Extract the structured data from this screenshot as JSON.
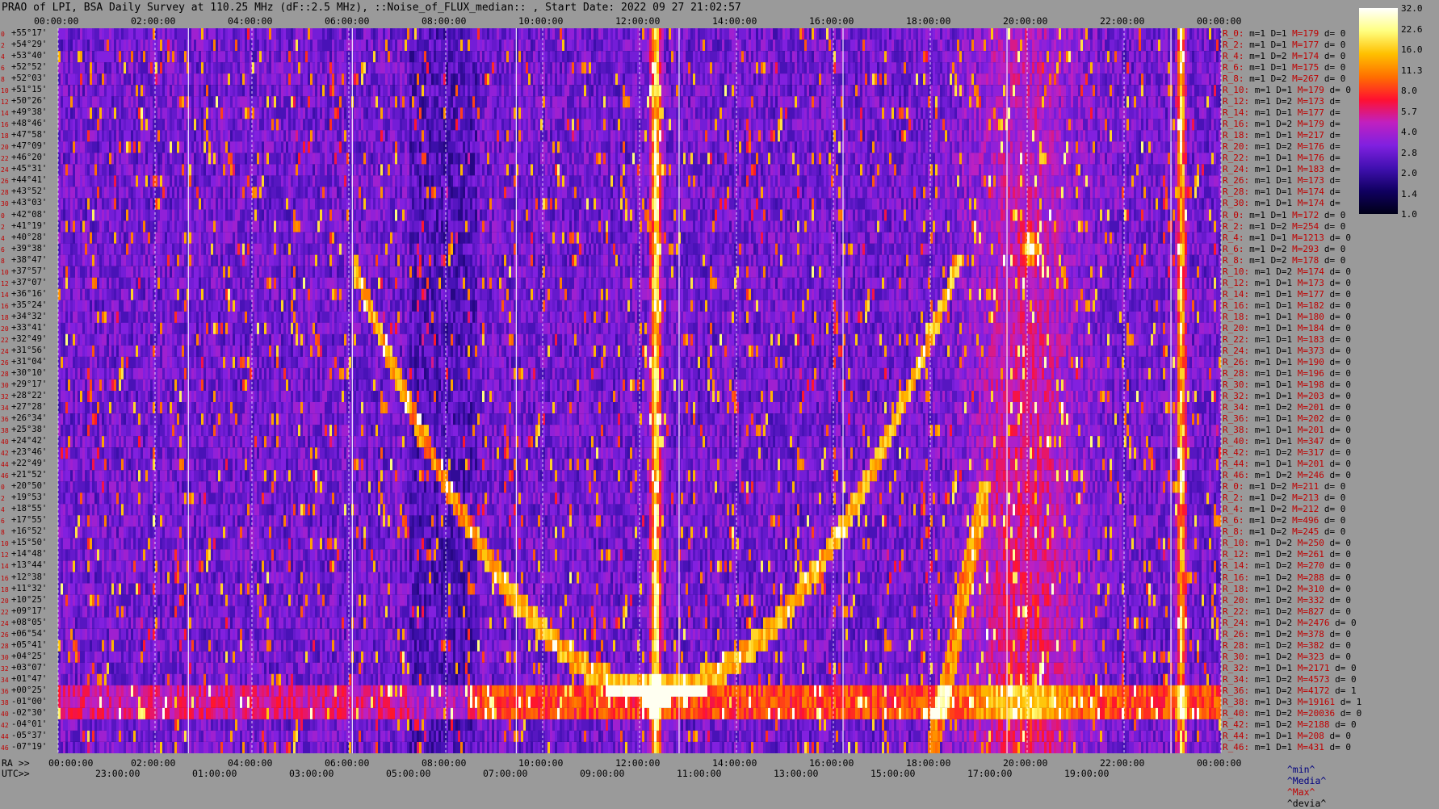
{
  "title": "PRAO of LPI, BSA Daily Survey at 110.25 MHz (dF::2.5 MHz), ::Noise_of_FLUX_median:: , Start Date: 2022 09 27 21:02:57",
  "chart_data": {
    "type": "heatmap",
    "title": "PRAO of LPI, BSA Daily Survey at 110.25 MHz (dF::2.5 MHz), ::Noise_of_FLUX_median:: , Start Date: 2022 09 27 21:02:57",
    "x_top_ticks": [
      "00:00:00",
      "02:00:00",
      "04:00:00",
      "06:00:00",
      "08:00:00",
      "10:00:00",
      "12:00:00",
      "14:00:00",
      "16:00:00",
      "18:00:00",
      "20:00:00",
      "22:00:00",
      "00:00:00"
    ],
    "x_ra_label": "RA >>",
    "x_ra_ticks": [
      "00:00:00",
      "02:00:00",
      "04:00:00",
      "06:00:00",
      "08:00:00",
      "10:00:00",
      "12:00:00",
      "14:00:00",
      "16:00:00",
      "18:00:00",
      "20:00:00",
      "22:00:00",
      "00:00:00"
    ],
    "x_utc_label": "UTC>>",
    "x_utc_ticks": [
      "23:00:00",
      "01:00:00",
      "03:00:00",
      "05:00:00",
      "07:00:00",
      "09:00:00",
      "11:00:00",
      "13:00:00",
      "15:00:00",
      "17:00:00",
      "19:00:00"
    ],
    "colorbar": {
      "ticks": [
        "32.0",
        "22.6",
        "16.0",
        "11.3",
        "8.0",
        "5.7",
        "4.0",
        "2.8",
        "2.0",
        "1.4",
        "1.0"
      ],
      "range": [
        1.0,
        32.0
      ],
      "scale": "log",
      "colors": [
        "#000018",
        "#100060",
        "#4010b0",
        "#8020e0",
        "#c020c0",
        "#ff1030",
        "#ff7000",
        "#ffc000",
        "#ffff80",
        "#ffffff"
      ]
    },
    "rows": [
      {
        "dec": "+55°17'",
        "beam": "0",
        "r": "R_0:",
        "m": "1",
        "d": "1",
        "max": "179",
        "dev": "0"
      },
      {
        "dec": "+54°29'",
        "beam": "2",
        "r": "R_2:",
        "m": "1",
        "d": "1",
        "max": "177",
        "dev": "0"
      },
      {
        "dec": "+53°40'",
        "beam": "4",
        "r": "R_4:",
        "m": "1",
        "d": "2",
        "max": "174",
        "dev": "0"
      },
      {
        "dec": "+52°52'",
        "beam": "6",
        "r": "R_6:",
        "m": "1",
        "d": "1",
        "max": "175",
        "dev": "0"
      },
      {
        "dec": "+52°03'",
        "beam": "8",
        "r": "R_8:",
        "m": "1",
        "d": "2",
        "max": "267",
        "dev": "0"
      },
      {
        "dec": "+51°15'",
        "beam": "10",
        "r": "R_10:",
        "m": "1",
        "d": "1",
        "max": "179",
        "dev": "0"
      },
      {
        "dec": "+50°26'",
        "beam": "12",
        "r": "R_12:",
        "m": "1",
        "d": "2",
        "max": "173",
        "dev": ""
      },
      {
        "dec": "+49°38'",
        "beam": "14",
        "r": "R_14:",
        "m": "1",
        "d": "1",
        "max": "177",
        "dev": ""
      },
      {
        "dec": "+48°46'",
        "beam": "16",
        "r": "R_16:",
        "m": "1",
        "d": "2",
        "max": "179",
        "dev": ""
      },
      {
        "dec": "+47°58'",
        "beam": "18",
        "r": "R_18:",
        "m": "1",
        "d": "1",
        "max": "217",
        "dev": ""
      },
      {
        "dec": "+47°09'",
        "beam": "20",
        "r": "R_20:",
        "m": "1",
        "d": "2",
        "max": "176",
        "dev": ""
      },
      {
        "dec": "+46°20'",
        "beam": "22",
        "r": "R_22:",
        "m": "1",
        "d": "1",
        "max": "176",
        "dev": ""
      },
      {
        "dec": "+45°31'",
        "beam": "24",
        "r": "R_24:",
        "m": "1",
        "d": "1",
        "max": "183",
        "dev": ""
      },
      {
        "dec": "+44°41'",
        "beam": "26",
        "r": "R_26:",
        "m": "1",
        "d": "1",
        "max": "173",
        "dev": ""
      },
      {
        "dec": "+43°52'",
        "beam": "28",
        "r": "R_28:",
        "m": "1",
        "d": "1",
        "max": "174",
        "dev": ""
      },
      {
        "dec": "+43°03'",
        "beam": "30",
        "r": "R_30:",
        "m": "1",
        "d": "1",
        "max": "174",
        "dev": ""
      },
      {
        "dec": "+42°08'",
        "beam": "0",
        "r": "R_0:",
        "m": "1",
        "d": "1",
        "max": "172",
        "dev": "0"
      },
      {
        "dec": "+41°19'",
        "beam": "2",
        "r": "R_2:",
        "m": "1",
        "d": "2",
        "max": "254",
        "dev": "0"
      },
      {
        "dec": "+40°28'",
        "beam": "4",
        "r": "R_4:",
        "m": "1",
        "d": "1",
        "max": "1213",
        "dev": "0"
      },
      {
        "dec": "+39°38'",
        "beam": "6",
        "r": "R_6:",
        "m": "1",
        "d": "2",
        "max": "293",
        "dev": "0"
      },
      {
        "dec": "+38°47'",
        "beam": "8",
        "r": "R_8:",
        "m": "1",
        "d": "2",
        "max": "178",
        "dev": "0"
      },
      {
        "dec": "+37°57'",
        "beam": "10",
        "r": "R_10:",
        "m": "1",
        "d": "2",
        "max": "174",
        "dev": "0"
      },
      {
        "dec": "+37°07'",
        "beam": "12",
        "r": "R_12:",
        "m": "1",
        "d": "1",
        "max": "173",
        "dev": "0"
      },
      {
        "dec": "+36°16'",
        "beam": "14",
        "r": "R_14:",
        "m": "1",
        "d": "1",
        "max": "177",
        "dev": "0"
      },
      {
        "dec": "+35°24'",
        "beam": "16",
        "r": "R_16:",
        "m": "1",
        "d": "1",
        "max": "182",
        "dev": "0"
      },
      {
        "dec": "+34°32'",
        "beam": "18",
        "r": "R_18:",
        "m": "1",
        "d": "1",
        "max": "180",
        "dev": "0"
      },
      {
        "dec": "+33°41'",
        "beam": "20",
        "r": "R_20:",
        "m": "1",
        "d": "1",
        "max": "184",
        "dev": "0"
      },
      {
        "dec": "+32°49'",
        "beam": "22",
        "r": "R_22:",
        "m": "1",
        "d": "1",
        "max": "183",
        "dev": "0"
      },
      {
        "dec": "+31°56'",
        "beam": "24",
        "r": "R_24:",
        "m": "1",
        "d": "1",
        "max": "373",
        "dev": "0"
      },
      {
        "dec": "+31°04'",
        "beam": "26",
        "r": "R_26:",
        "m": "1",
        "d": "1",
        "max": "190",
        "dev": "0"
      },
      {
        "dec": "+30°10'",
        "beam": "28",
        "r": "R_28:",
        "m": "1",
        "d": "1",
        "max": "196",
        "dev": "0"
      },
      {
        "dec": "+29°17'",
        "beam": "30",
        "r": "R_30:",
        "m": "1",
        "d": "1",
        "max": "198",
        "dev": "0"
      },
      {
        "dec": "+28°22'",
        "beam": "32",
        "r": "R_32:",
        "m": "1",
        "d": "1",
        "max": "203",
        "dev": "0"
      },
      {
        "dec": "+27°28'",
        "beam": "34",
        "r": "R_34:",
        "m": "1",
        "d": "2",
        "max": "201",
        "dev": "0"
      },
      {
        "dec": "+26°34'",
        "beam": "36",
        "r": "R_36:",
        "m": "1",
        "d": "1",
        "max": "202",
        "dev": "0"
      },
      {
        "dec": "+25°38'",
        "beam": "38",
        "r": "R_38:",
        "m": "1",
        "d": "1",
        "max": "201",
        "dev": "0"
      },
      {
        "dec": "+24°42'",
        "beam": "40",
        "r": "R_40:",
        "m": "1",
        "d": "1",
        "max": "347",
        "dev": "0"
      },
      {
        "dec": "+23°46'",
        "beam": "42",
        "r": "R_42:",
        "m": "1",
        "d": "2",
        "max": "317",
        "dev": "0"
      },
      {
        "dec": "+22°49'",
        "beam": "44",
        "r": "R_44:",
        "m": "1",
        "d": "1",
        "max": "201",
        "dev": "0"
      },
      {
        "dec": "+21°52'",
        "beam": "46",
        "r": "R_46:",
        "m": "1",
        "d": "2",
        "max": "246",
        "dev": "0"
      },
      {
        "dec": "+20°50'",
        "beam": "0",
        "r": "R_0:",
        "m": "1",
        "d": "2",
        "max": "211",
        "dev": "0"
      },
      {
        "dec": "+19°53'",
        "beam": "2",
        "r": "R_2:",
        "m": "1",
        "d": "2",
        "max": "213",
        "dev": "0"
      },
      {
        "dec": "+18°55'",
        "beam": "4",
        "r": "R_4:",
        "m": "1",
        "d": "2",
        "max": "212",
        "dev": "0"
      },
      {
        "dec": "+17°55'",
        "beam": "6",
        "r": "R_6:",
        "m": "1",
        "d": "2",
        "max": "496",
        "dev": "0"
      },
      {
        "dec": "+16°52'",
        "beam": "8",
        "r": "R_8:",
        "m": "1",
        "d": "2",
        "max": "245",
        "dev": "0"
      },
      {
        "dec": "+15°50'",
        "beam": "10",
        "r": "R_10:",
        "m": "1",
        "d": "2",
        "max": "250",
        "dev": "0"
      },
      {
        "dec": "+14°48'",
        "beam": "12",
        "r": "R_12:",
        "m": "1",
        "d": "2",
        "max": "261",
        "dev": "0"
      },
      {
        "dec": "+13°44'",
        "beam": "14",
        "r": "R_14:",
        "m": "1",
        "d": "2",
        "max": "270",
        "dev": "0"
      },
      {
        "dec": "+12°38'",
        "beam": "16",
        "r": "R_16:",
        "m": "1",
        "d": "2",
        "max": "288",
        "dev": "0"
      },
      {
        "dec": "+11°32'",
        "beam": "18",
        "r": "R_18:",
        "m": "1",
        "d": "2",
        "max": "310",
        "dev": "0"
      },
      {
        "dec": "+10°25'",
        "beam": "20",
        "r": "R_20:",
        "m": "1",
        "d": "2",
        "max": "332",
        "dev": "0"
      },
      {
        "dec": "+09°17'",
        "beam": "22",
        "r": "R_22:",
        "m": "1",
        "d": "2",
        "max": "827",
        "dev": "0"
      },
      {
        "dec": "+08°05'",
        "beam": "24",
        "r": "R_24:",
        "m": "1",
        "d": "2",
        "max": "2476",
        "dev": "0"
      },
      {
        "dec": "+06°54'",
        "beam": "26",
        "r": "R_26:",
        "m": "1",
        "d": "2",
        "max": "378",
        "dev": "0"
      },
      {
        "dec": "+05°41'",
        "beam": "28",
        "r": "R_28:",
        "m": "1",
        "d": "2",
        "max": "382",
        "dev": "0"
      },
      {
        "dec": "+04°25'",
        "beam": "30",
        "r": "R_30:",
        "m": "1",
        "d": "2",
        "max": "323",
        "dev": "0"
      },
      {
        "dec": "+03°07'",
        "beam": "32",
        "r": "R_32:",
        "m": "1",
        "d": "1",
        "max": "2171",
        "dev": "0"
      },
      {
        "dec": "+01°47'",
        "beam": "34",
        "r": "R_34:",
        "m": "1",
        "d": "2",
        "max": "4573",
        "dev": "0"
      },
      {
        "dec": "+00°25'",
        "beam": "36",
        "r": "R_36:",
        "m": "1",
        "d": "2",
        "max": "4172",
        "dev": "1"
      },
      {
        "dec": "-01°00'",
        "beam": "38",
        "r": "R_38:",
        "m": "1",
        "d": "3",
        "max": "19161",
        "dev": "1"
      },
      {
        "dec": "-02°30'",
        "beam": "40",
        "r": "R_40:",
        "m": "1",
        "d": "2",
        "max": "20036",
        "dev": "0"
      },
      {
        "dec": "-04°01'",
        "beam": "42",
        "r": "R_42:",
        "m": "1",
        "d": "2",
        "max": "2188",
        "dev": "0"
      },
      {
        "dec": "-05°37'",
        "beam": "44",
        "r": "R_44:",
        "m": "1",
        "d": "1",
        "max": "208",
        "dev": "0"
      },
      {
        "dec": "-07°19'",
        "beam": "46",
        "r": "R_46:",
        "m": "1",
        "d": "1",
        "max": "431",
        "dev": "0"
      }
    ],
    "legend": {
      "min": "^min^",
      "median": "^Media^",
      "max": "^Max^",
      "devia": "^devia^"
    }
  }
}
